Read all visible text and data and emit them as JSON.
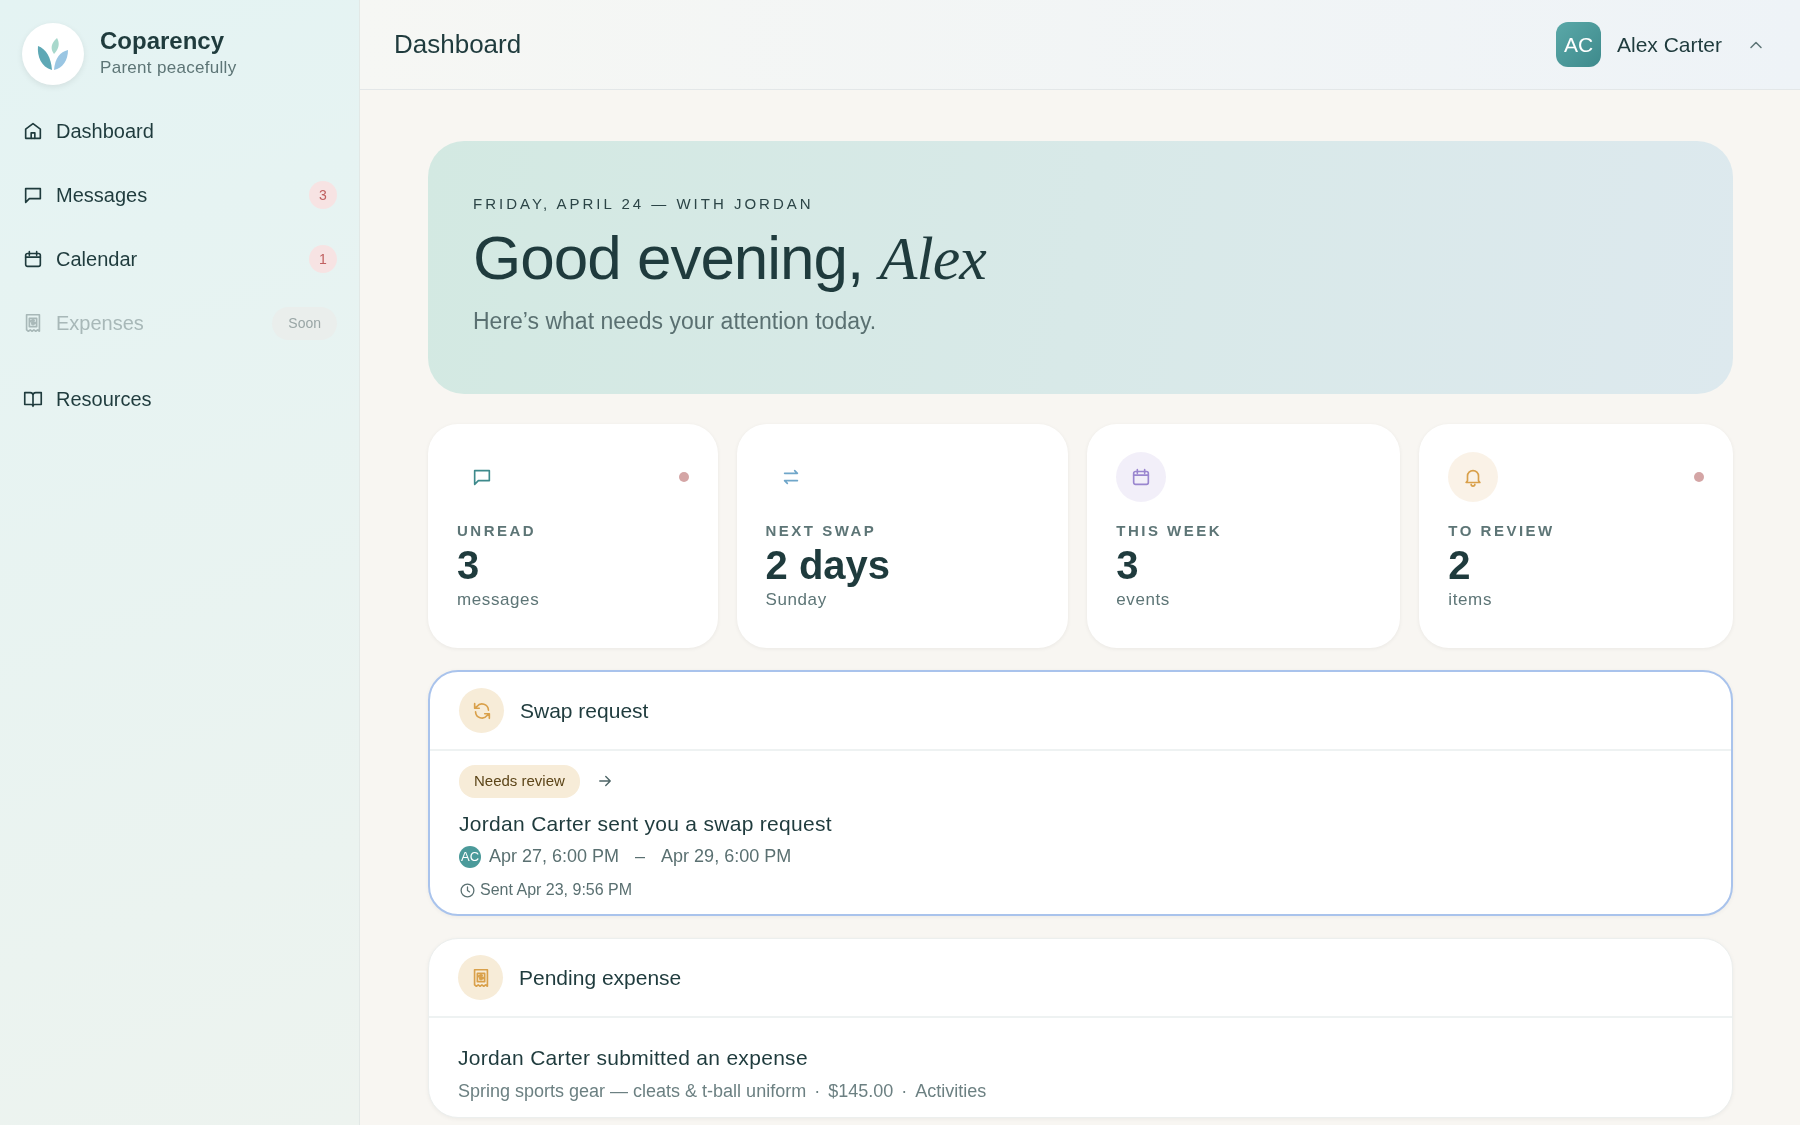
{
  "brand": {
    "name": "Coparency",
    "tagline": "Parent peacefully"
  },
  "nav_groups": [
    [
      {
        "label": "Dashboard",
        "disabled": false
      },
      {
        "label": "Messages",
        "disabled": false,
        "badge": {
          "text": "3",
          "kind": "count"
        }
      },
      {
        "label": "Calendar",
        "disabled": false,
        "badge": {
          "text": "1",
          "kind": "count"
        }
      },
      {
        "label": "Expenses",
        "disabled": true,
        "badge": {
          "text": "Soon",
          "kind": "tag"
        }
      }
    ],
    [
      {
        "label": "Resources",
        "disabled": false
      }
    ]
  ],
  "header": {
    "title": "Dashboard",
    "user": {
      "initials": "AC",
      "name": "Alex Carter",
      "expanded": true
    }
  },
  "hero": {
    "eyebrow": "FRIDAY, APRIL 24 — WITH JORDAN",
    "greeting": "Good evening, *Alex*",
    "subtitle": "Here’s what needs your attention today."
  },
  "stats": [
    {
      "color": "#3e8a8c",
      "tinted": false,
      "dot": true,
      "label": "UNREAD",
      "value": "3",
      "unit": "messages"
    },
    {
      "color": "#6fa6c9",
      "tinted": false,
      "dot": false,
      "label": "NEXT SWAP",
      "value": "2 days",
      "unit": "Sunday"
    },
    {
      "color": "#9a86cf",
      "tinted": true,
      "dot": false,
      "label": "THIS WEEK",
      "value": "3",
      "unit": "events"
    },
    {
      "color": "#d9a04a",
      "tinted": true,
      "dot": true,
      "label": "TO REVIEW",
      "value": "2",
      "unit": "items"
    }
  ],
  "cards": [
    {
      "kind": "swap",
      "title": "Swap request",
      "highlighted": true,
      "status": "Needs review",
      "headline": "Jordan Carter sent you a swap request",
      "avatar": "AC",
      "range": [
        "Apr 27, 6:00 PM",
        "–",
        "Apr 29, 6:00 PM"
      ],
      "sent": "Sent Apr 23, 9:56 PM"
    },
    {
      "kind": "expense",
      "title": "Pending expense",
      "highlighted": false,
      "headline": "Jordan Carter submitted an expense",
      "meta": [
        "Spring sports gear — cleats & t-ball uniform",
        "·",
        "$145.00",
        "·",
        "Activities"
      ]
    }
  ]
}
